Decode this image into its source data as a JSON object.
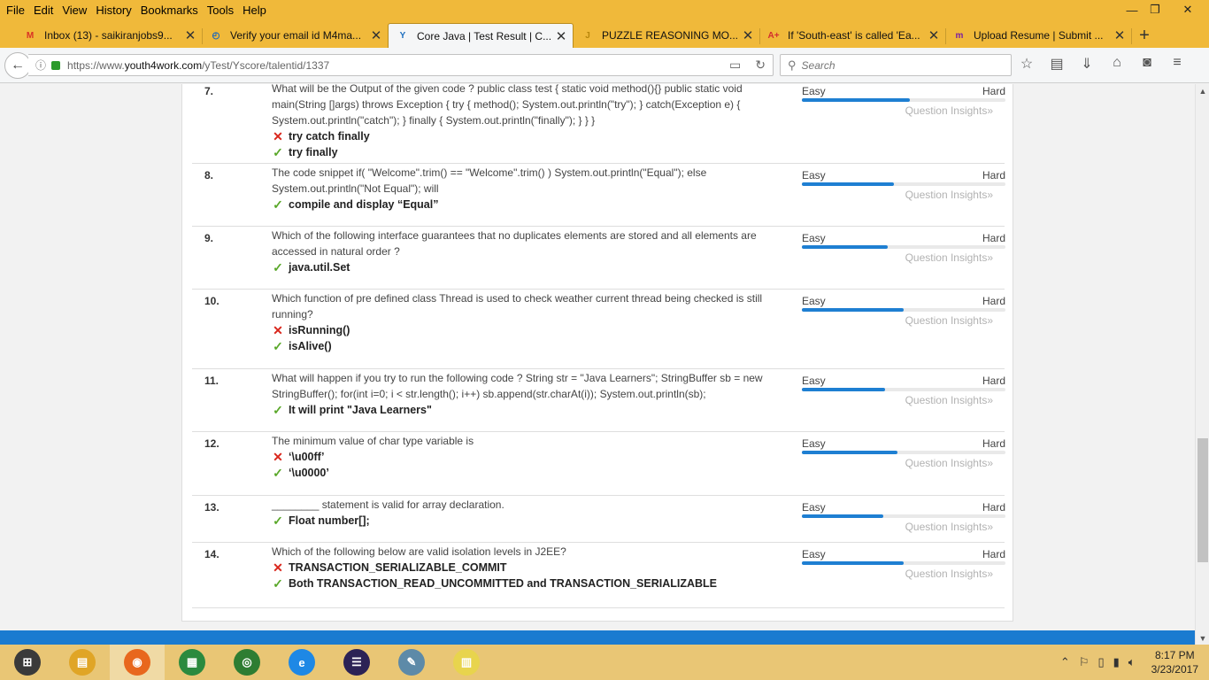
{
  "menu": [
    "File",
    "Edit",
    "View",
    "History",
    "Bookmarks",
    "Tools",
    "Help"
  ],
  "window_controls": {
    "minimize": "—",
    "restore": "❐",
    "close": "✕"
  },
  "tabs": [
    {
      "title": "Inbox (13) - saikiranjobs9...",
      "icon": "M",
      "icon_color": "#d93025"
    },
    {
      "title": "Verify your email id M4ma...",
      "icon": "◴",
      "icon_color": "#1565c0"
    },
    {
      "title": "Core Java | Test Result | C...",
      "icon": "Y",
      "icon_color": "#1e6fbf"
    },
    {
      "title": "PUZZLE REASONING MO...",
      "icon": "J",
      "icon_color": "#b8860b"
    },
    {
      "title": "If 'South-east' is called 'Ea...",
      "icon": "A+",
      "icon_color": "#d32f2f"
    },
    {
      "title": "Upload Resume | Submit ...",
      "icon": "m",
      "icon_color": "#7b1fa2"
    }
  ],
  "new_tab": "+",
  "url": {
    "prefix": "https://www.",
    "domain": "youth4work.com",
    "path": "/yTest/Yscore/talentid/1337"
  },
  "search": {
    "placeholder": "Search"
  },
  "difficulty": {
    "easy": "Easy",
    "hard": "Hard",
    "insights": "Question Insights»"
  },
  "questions": [
    {
      "num": "7.",
      "text": "What will be the Output of the given code ? public class test { static void method(){} public static void main(String []args) throws Exception { try { method(); System.out.println(\"try\"); } catch(Exception e) { System.out.println(\"catch\"); } finally { System.out.println(\"finally\"); } } }",
      "answers": [
        {
          "mark": "wrong",
          "text": "try catch finally"
        },
        {
          "mark": "right",
          "text": "try finally"
        }
      ],
      "difficulty": 0.53
    },
    {
      "num": "8.",
      "text": "The code snippet if( \"Welcome\".trim() == \"Welcome\".trim() ) System.out.println(\"Equal\"); else System.out.println(\"Not Equal\"); will",
      "answers": [
        {
          "mark": "right",
          "text": "compile and display “Equal”"
        }
      ],
      "difficulty": 0.45
    },
    {
      "num": "9.",
      "text": "Which of the following interface guarantees that no duplicates elements are stored and all elements are accessed in natural order ?",
      "answers": [
        {
          "mark": "right",
          "text": "java.util.Set"
        }
      ],
      "difficulty": 0.42
    },
    {
      "num": "10.",
      "text": "Which function of pre defined class Thread is used to check weather current thread being checked is still running?",
      "answers": [
        {
          "mark": "wrong",
          "text": "isRunning()"
        },
        {
          "mark": "right",
          "text": "isAlive()"
        }
      ],
      "difficulty": 0.5
    },
    {
      "num": "11.",
      "text": "What will happen if you try to run the following code ? String str = \"Java Learners\"; StringBuffer sb = new StringBuffer(); for(int i=0; i < str.length(); i++) sb.append(str.charAt(i)); System.out.println(sb);",
      "answers": [
        {
          "mark": "right",
          "text": "It will print \"Java Learners\""
        }
      ],
      "difficulty": 0.41
    },
    {
      "num": "12.",
      "text": "The minimum value of char type variable is",
      "answers": [
        {
          "mark": "wrong",
          "text": "‘\\u00ff’"
        },
        {
          "mark": "right",
          "text": "‘\\u0000’"
        }
      ],
      "difficulty": 0.47
    },
    {
      "num": "13.",
      "text": "________ statement is valid for array declaration.",
      "answers": [
        {
          "mark": "right",
          "text": "Float number[];"
        }
      ],
      "difficulty": 0.4
    },
    {
      "num": "14.",
      "text": "Which of the following below are valid isolation levels in J2EE?",
      "answers": [
        {
          "mark": "wrong",
          "text": "TRANSACTION_SERIALIZABLE_COMMIT"
        },
        {
          "mark": "right",
          "text": "Both TRANSACTION_READ_UNCOMMITTED and TRANSACTION_SERIALIZABLE"
        }
      ],
      "difficulty": 0.5
    }
  ],
  "taskbar": {
    "apps": [
      {
        "name": "windows-start",
        "glyph": "⊞",
        "color": "#3a3a3a"
      },
      {
        "name": "file-explorer",
        "glyph": "▤",
        "color": "#e0a526"
      },
      {
        "name": "firefox",
        "glyph": "◉",
        "color": "#e8671d"
      },
      {
        "name": "store",
        "glyph": "▦",
        "color": "#2b8a3e"
      },
      {
        "name": "chrome",
        "glyph": "◎",
        "color": "#2e7d32"
      },
      {
        "name": "internet-explorer",
        "glyph": "e",
        "color": "#1e88e5"
      },
      {
        "name": "eclipse",
        "glyph": "☰",
        "color": "#2c2255"
      },
      {
        "name": "notepad",
        "glyph": "✎",
        "color": "#5d8aa8"
      },
      {
        "name": "database",
        "glyph": "▥",
        "color": "#e8d44d"
      }
    ],
    "active_app": "firefox",
    "time": "8:17 PM",
    "date": "3/23/2017"
  }
}
